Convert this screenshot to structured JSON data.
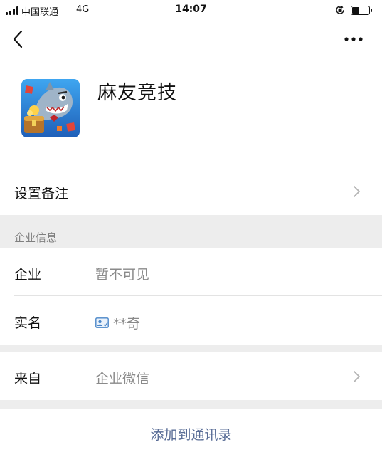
{
  "status_bar": {
    "carrier": "中国联通",
    "network": "4G",
    "time": "14:07",
    "battery_fraction": 0.45
  },
  "nav": {
    "back_icon": "chevron-left-icon",
    "more_icon": "ellipsis-icon"
  },
  "profile": {
    "name": "麻友竞技",
    "avatar_icon": "game-avatar-icon"
  },
  "remark_row": {
    "label": "设置备注"
  },
  "company_section": {
    "title": "企业信息",
    "company_label": "企业",
    "company_value": "暂不可见",
    "realname_label": "实名",
    "realname_value": "**奇"
  },
  "source_row": {
    "label": "来自",
    "value": "企业微信"
  },
  "actions": {
    "add_contact_label": "添加到通讯录"
  },
  "colors": {
    "link": "#576b95",
    "secondary_text": "#8a8a8a",
    "background": "#ededed"
  }
}
